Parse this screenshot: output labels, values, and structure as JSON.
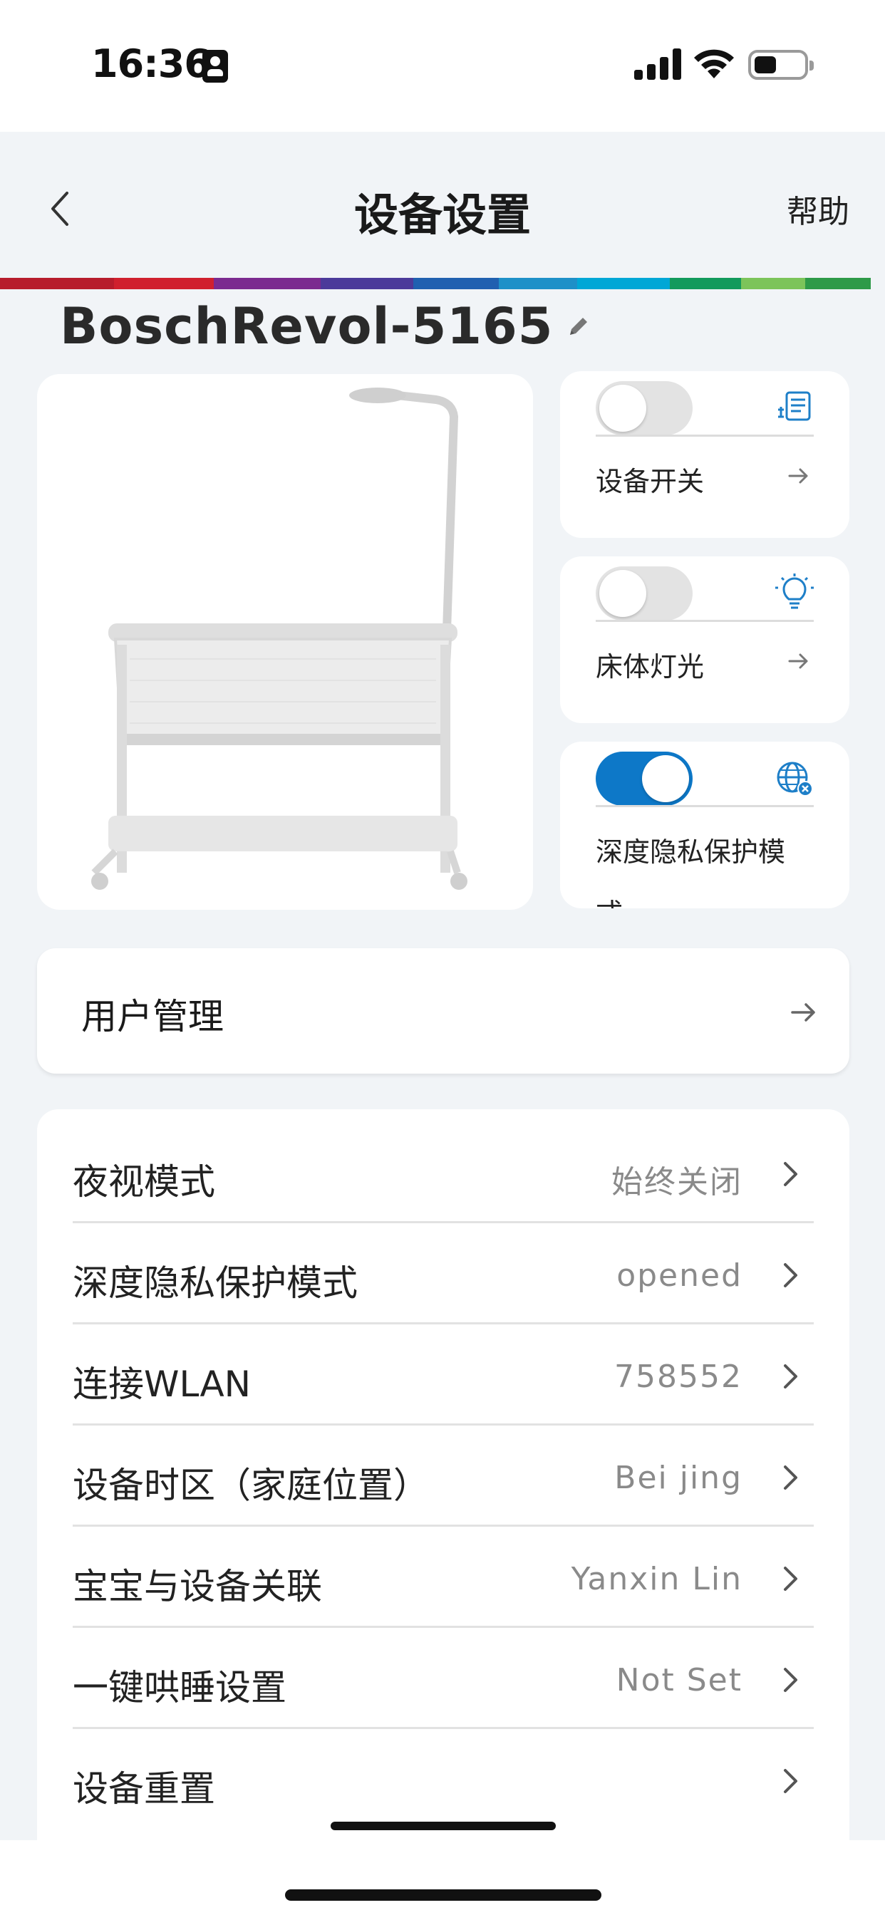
{
  "status_bar": {
    "time": "16:36"
  },
  "nav": {
    "title": "设备设置",
    "help_label": "帮助"
  },
  "device": {
    "name": "BoschRevol-5165"
  },
  "toggles": [
    {
      "label": "设备开关",
      "on": false,
      "icon": "plug-panel-icon"
    },
    {
      "label": "床体灯光",
      "on": false,
      "icon": "lightbulb-icon"
    },
    {
      "label": "深度隐私保护模式",
      "on": true,
      "icon": "globe-block-icon"
    }
  ],
  "user_management": {
    "label": "用户管理"
  },
  "settings": [
    {
      "label": "夜视模式",
      "value": "始终关闭"
    },
    {
      "label": "深度隐私保护模式",
      "value": "opened"
    },
    {
      "label": "连接WLAN",
      "value": "758552"
    },
    {
      "label": "设备时区（家庭位置）",
      "value": "Bei jing"
    },
    {
      "label": "宝宝与设备关联",
      "value": "Yanxin Lin"
    },
    {
      "label": "一键哄睡设置",
      "value": "Not Set"
    },
    {
      "label": "设备重置",
      "value": ""
    }
  ],
  "colors": {
    "accent": "#0d78c8",
    "toggle_off": "#e3e3e3",
    "background": "#f1f4f7",
    "rainbow": [
      "#b71c2c",
      "#d0202e",
      "#7b2a8f",
      "#4b3a9a",
      "#2060b0",
      "#1e90c8",
      "#00a7d6",
      "#129a5c",
      "#7cc45a",
      "#2e9a48"
    ]
  }
}
